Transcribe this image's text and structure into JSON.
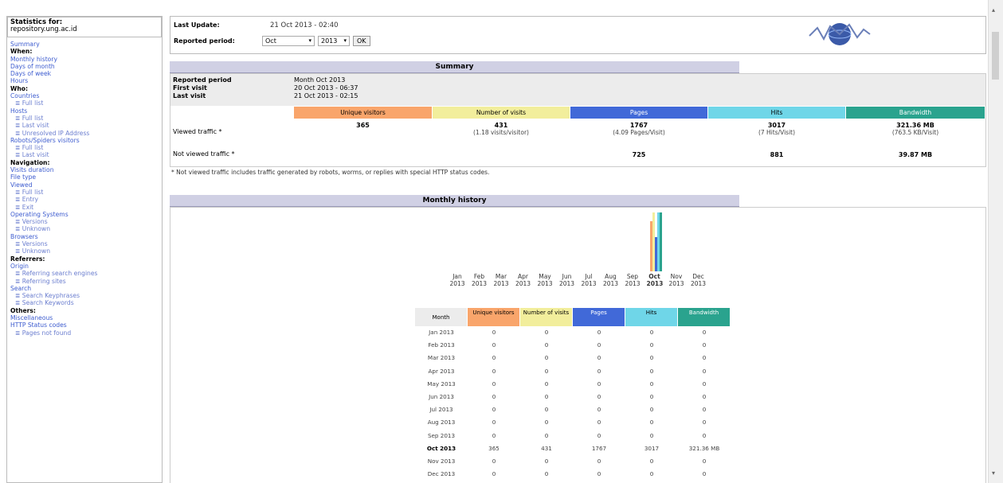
{
  "sidebar": {
    "stats_for_label": "Statistics for:",
    "site": "repository.ung.ac.id",
    "items": [
      {
        "text": "Summary",
        "kind": "link"
      },
      {
        "text": "When:",
        "kind": "head"
      },
      {
        "text": "Monthly history",
        "kind": "link"
      },
      {
        "text": "Days of month",
        "kind": "link"
      },
      {
        "text": "Days of week",
        "kind": "link"
      },
      {
        "text": "Hours",
        "kind": "link"
      },
      {
        "text": "Who:",
        "kind": "head"
      },
      {
        "text": "Countries",
        "kind": "link"
      },
      {
        "text": "Full list",
        "kind": "sub"
      },
      {
        "text": "Hosts",
        "kind": "link"
      },
      {
        "text": "Full list",
        "kind": "sub"
      },
      {
        "text": "Last visit",
        "kind": "sub"
      },
      {
        "text": "Unresolved IP Address",
        "kind": "sub"
      },
      {
        "text": "Robots/Spiders visitors",
        "kind": "link"
      },
      {
        "text": "Full list",
        "kind": "sub"
      },
      {
        "text": "Last visit",
        "kind": "sub"
      },
      {
        "text": "Navigation:",
        "kind": "head"
      },
      {
        "text": "Visits duration",
        "kind": "link"
      },
      {
        "text": "File type",
        "kind": "link"
      },
      {
        "text": "Viewed",
        "kind": "link"
      },
      {
        "text": "Full list",
        "kind": "sub"
      },
      {
        "text": "Entry",
        "kind": "sub"
      },
      {
        "text": "Exit",
        "kind": "sub"
      },
      {
        "text": "Operating Systems",
        "kind": "link"
      },
      {
        "text": "Versions",
        "kind": "sub"
      },
      {
        "text": "Unknown",
        "kind": "sub"
      },
      {
        "text": "Browsers",
        "kind": "link"
      },
      {
        "text": "Versions",
        "kind": "sub"
      },
      {
        "text": "Unknown",
        "kind": "sub"
      },
      {
        "text": "Referrers:",
        "kind": "head"
      },
      {
        "text": "Origin",
        "kind": "link"
      },
      {
        "text": "Referring search engines",
        "kind": "sub"
      },
      {
        "text": "Referring sites",
        "kind": "sub"
      },
      {
        "text": "Search",
        "kind": "link"
      },
      {
        "text": "Search Keyphrases",
        "kind": "sub"
      },
      {
        "text": "Search Keywords",
        "kind": "sub"
      },
      {
        "text": "Others:",
        "kind": "head"
      },
      {
        "text": "Miscellaneous",
        "kind": "link"
      },
      {
        "text": "HTTP Status codes",
        "kind": "link"
      },
      {
        "text": "Pages not found",
        "kind": "sub"
      }
    ]
  },
  "header": {
    "last_update_label": "Last Update:",
    "last_update_value": "21 Oct 2013 - 02:40",
    "reported_period_label": "Reported period:",
    "month_select": "Oct",
    "year_select": "2013",
    "ok_label": "OK"
  },
  "summary": {
    "title": "Summary",
    "reported_period_label": "Reported period",
    "reported_period_value": "Month Oct 2013",
    "first_visit_label": "First visit",
    "first_visit_value": "20 Oct 2013 - 06:37",
    "last_visit_label": "Last visit",
    "last_visit_value": "21 Oct 2013 - 02:15",
    "col_unique": "Unique visitors",
    "col_visits": "Number of visits",
    "col_pages": "Pages",
    "col_hits": "Hits",
    "col_bandwidth": "Bandwidth",
    "viewed_label": "Viewed traffic *",
    "viewed": {
      "unique": "365",
      "visits": "431",
      "visits_sub": "(1.18 visits/visitor)",
      "pages": "1767",
      "pages_sub": "(4.09 Pages/Visit)",
      "hits": "3017",
      "hits_sub": "(7 Hits/Visit)",
      "bandwidth": "321.36 MB",
      "bandwidth_sub": "(763.5 KB/Visit)"
    },
    "not_viewed_label": "Not viewed traffic *",
    "not_viewed": {
      "pages": "725",
      "hits": "881",
      "bandwidth": "39.87 MB"
    },
    "footnote": "* Not viewed traffic includes traffic generated by robots, worms, or replies with special HTTP status codes."
  },
  "monthly": {
    "title": "Monthly history",
    "months": [
      "Jan",
      "Feb",
      "Mar",
      "Apr",
      "May",
      "Jun",
      "Jul",
      "Aug",
      "Sep",
      "Oct",
      "Nov",
      "Dec"
    ],
    "year": "2013",
    "current_month_index": 9,
    "table_headers": {
      "month": "Month",
      "unique": "Unique visitors",
      "visits": "Number of visits",
      "pages": "Pages",
      "hits": "Hits",
      "bandwidth": "Bandwidth"
    },
    "rows": [
      {
        "month": "Jan 2013",
        "unique": "0",
        "visits": "0",
        "pages": "0",
        "hits": "0",
        "bandwidth": "0"
      },
      {
        "month": "Feb 2013",
        "unique": "0",
        "visits": "0",
        "pages": "0",
        "hits": "0",
        "bandwidth": "0"
      },
      {
        "month": "Mar 2013",
        "unique": "0",
        "visits": "0",
        "pages": "0",
        "hits": "0",
        "bandwidth": "0"
      },
      {
        "month": "Apr 2013",
        "unique": "0",
        "visits": "0",
        "pages": "0",
        "hits": "0",
        "bandwidth": "0"
      },
      {
        "month": "May 2013",
        "unique": "0",
        "visits": "0",
        "pages": "0",
        "hits": "0",
        "bandwidth": "0"
      },
      {
        "month": "Jun 2013",
        "unique": "0",
        "visits": "0",
        "pages": "0",
        "hits": "0",
        "bandwidth": "0"
      },
      {
        "month": "Jul 2013",
        "unique": "0",
        "visits": "0",
        "pages": "0",
        "hits": "0",
        "bandwidth": "0"
      },
      {
        "month": "Aug 2013",
        "unique": "0",
        "visits": "0",
        "pages": "0",
        "hits": "0",
        "bandwidth": "0"
      },
      {
        "month": "Sep 2013",
        "unique": "0",
        "visits": "0",
        "pages": "0",
        "hits": "0",
        "bandwidth": "0"
      },
      {
        "month": "Oct 2013",
        "unique": "365",
        "visits": "431",
        "pages": "1767",
        "hits": "3017",
        "bandwidth": "321.36 MB"
      },
      {
        "month": "Nov 2013",
        "unique": "0",
        "visits": "0",
        "pages": "0",
        "hits": "0",
        "bandwidth": "0"
      },
      {
        "month": "Dec 2013",
        "unique": "0",
        "visits": "0",
        "pages": "0",
        "hits": "0",
        "bandwidth": "0"
      }
    ],
    "chart_colors": {
      "unique": "#f9a56b",
      "visits": "#f2ee9c",
      "pages": "#4169d8",
      "hits": "#6fd6e8",
      "bandwidth": "#2aa38e"
    }
  },
  "chart_data": {
    "type": "bar",
    "categories": [
      "Jan 2013",
      "Feb 2013",
      "Mar 2013",
      "Apr 2013",
      "May 2013",
      "Jun 2013",
      "Jul 2013",
      "Aug 2013",
      "Sep 2013",
      "Oct 2013",
      "Nov 2013",
      "Dec 2013"
    ],
    "series": [
      {
        "name": "Unique visitors",
        "values": [
          0,
          0,
          0,
          0,
          0,
          0,
          0,
          0,
          0,
          365,
          0,
          0
        ]
      },
      {
        "name": "Number of visits",
        "values": [
          0,
          0,
          0,
          0,
          0,
          0,
          0,
          0,
          0,
          431,
          0,
          0
        ]
      },
      {
        "name": "Pages",
        "values": [
          0,
          0,
          0,
          0,
          0,
          0,
          0,
          0,
          0,
          1767,
          0,
          0
        ]
      },
      {
        "name": "Hits",
        "values": [
          0,
          0,
          0,
          0,
          0,
          0,
          0,
          0,
          0,
          3017,
          0,
          0
        ]
      },
      {
        "name": "Bandwidth",
        "values": [
          0,
          0,
          0,
          0,
          0,
          0,
          0,
          0,
          0,
          321.36,
          0,
          0
        ]
      }
    ]
  }
}
